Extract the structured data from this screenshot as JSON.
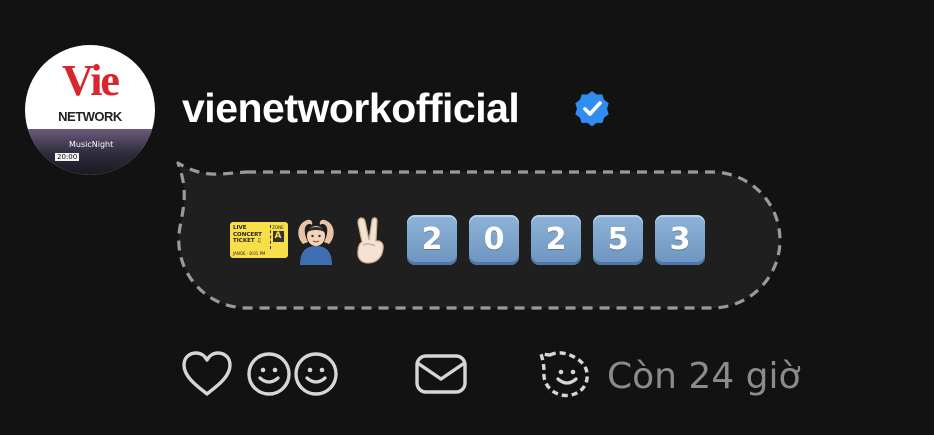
{
  "profile": {
    "username": "vienetworkofficial",
    "verified": true,
    "avatar": {
      "logo_top": "Vie",
      "logo_bottom": "NETWORK",
      "banner_title": "MusicNight",
      "banner_time": "20:00"
    }
  },
  "note": {
    "ticket": {
      "line1": "LIVE",
      "line2": "CONCERT",
      "line3": "TICKET ♫",
      "zone_label": "ZONE",
      "zone_value": "A",
      "footer": "JANOE · 8:01 PM"
    },
    "digits": [
      "2",
      "0",
      "2",
      "5",
      "3"
    ]
  },
  "actions": {
    "time_left_text": "Còn 24 giờ"
  },
  "colors": {
    "background": "#121212",
    "verified_badge": "#2f8cf0",
    "icon_stroke": "#d6d6d6",
    "muted_text": "#8b8b8b",
    "keycap": "#7aa3cc",
    "ticket": "#f8df49",
    "logo_red": "#d7262e"
  },
  "icons": {
    "like": "heart-icon",
    "reactions": "smiley-faces-icon",
    "message": "envelope-icon",
    "reply": "smiley-bubble-icon"
  }
}
